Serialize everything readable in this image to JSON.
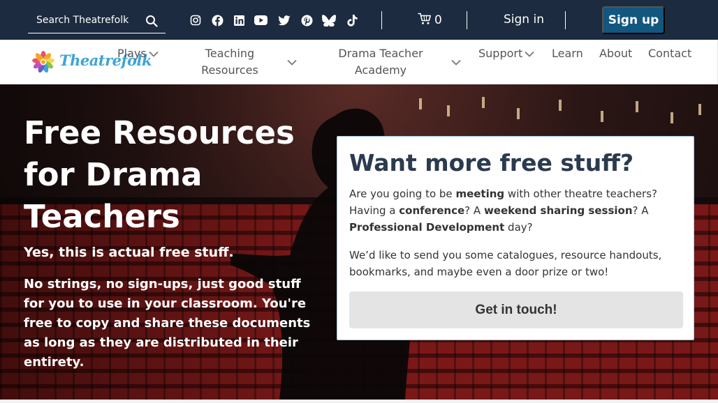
{
  "topbar": {
    "search_placeholder": "Search Theatrefolk",
    "social_icons": [
      "instagram-icon",
      "facebook-icon",
      "linkedin-icon",
      "youtube-icon",
      "twitter-icon",
      "pinterest-icon",
      "bluesky-icon",
      "tiktok-icon"
    ],
    "cart_count": "0",
    "signin_label": "Sign in",
    "signup_label": "Sign up"
  },
  "nav": {
    "logo_text": "Theatrefolk",
    "items": [
      {
        "label": "Plays"
      },
      {
        "label": "Teaching Resources"
      },
      {
        "label": "Drama Teacher Academy"
      },
      {
        "label": "Support"
      },
      {
        "label": "Learn"
      },
      {
        "label": "About"
      },
      {
        "label": "Contact"
      }
    ]
  },
  "hero": {
    "title": "Free Resources for Drama Teachers",
    "subtitle": "Yes, this is actual free stuff.",
    "body": "No strings, no sign-ups, just good stuff for you to use in your classroom. You're free to copy and share these documents as long as they are distributed in their entirety."
  },
  "card": {
    "title": "Want more free stuff?",
    "p1_parts": [
      "Are you going to be ",
      "meeting",
      " with other theatre teachers? Having a ",
      "conference",
      "? A ",
      "weekend sharing session",
      "? A ",
      "Professional Development",
      " day?"
    ],
    "p2": "We’d like to send you some catalogues, resource handouts, bookmarks, and maybe even a door prize or two!",
    "button_label": "Get in touch!"
  },
  "colors": {
    "topbar_bg": "#1c2b3f",
    "signup_bg": "#12577f",
    "nav_text": "#555555",
    "card_title": "#2b3a4f",
    "logo_blue": "#3ea3d8"
  }
}
